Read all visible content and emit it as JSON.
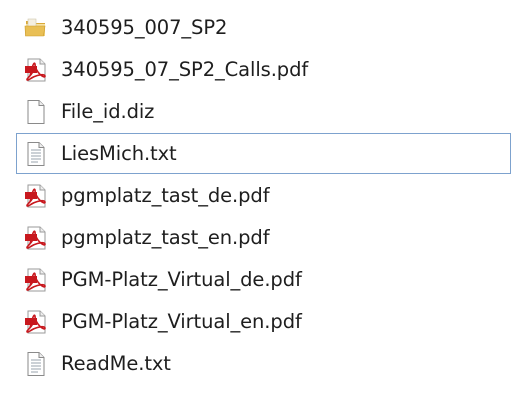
{
  "files": [
    {
      "name": "340595_007_SP2",
      "icon": "folder-icon",
      "selected": false
    },
    {
      "name": "340595_07_SP2_Calls.pdf",
      "icon": "pdf-icon",
      "selected": false
    },
    {
      "name": "File_id.diz",
      "icon": "file-icon",
      "selected": false
    },
    {
      "name": "LiesMich.txt",
      "icon": "text-file-icon",
      "selected": true
    },
    {
      "name": "pgmplatz_tast_de.pdf",
      "icon": "pdf-icon",
      "selected": false
    },
    {
      "name": "pgmplatz_tast_en.pdf",
      "icon": "pdf-icon",
      "selected": false
    },
    {
      "name": "PGM-Platz_Virtual_de.pdf",
      "icon": "pdf-icon",
      "selected": false
    },
    {
      "name": "PGM-Platz_Virtual_en.pdf",
      "icon": "pdf-icon",
      "selected": false
    },
    {
      "name": "ReadMe.txt",
      "icon": "text-file-icon",
      "selected": false
    }
  ],
  "colors": {
    "selection_border": "#7da2ce",
    "pdf_red": "#c8181e",
    "folder_yellow": "#e8c25a",
    "text": "#1e1e1e"
  }
}
